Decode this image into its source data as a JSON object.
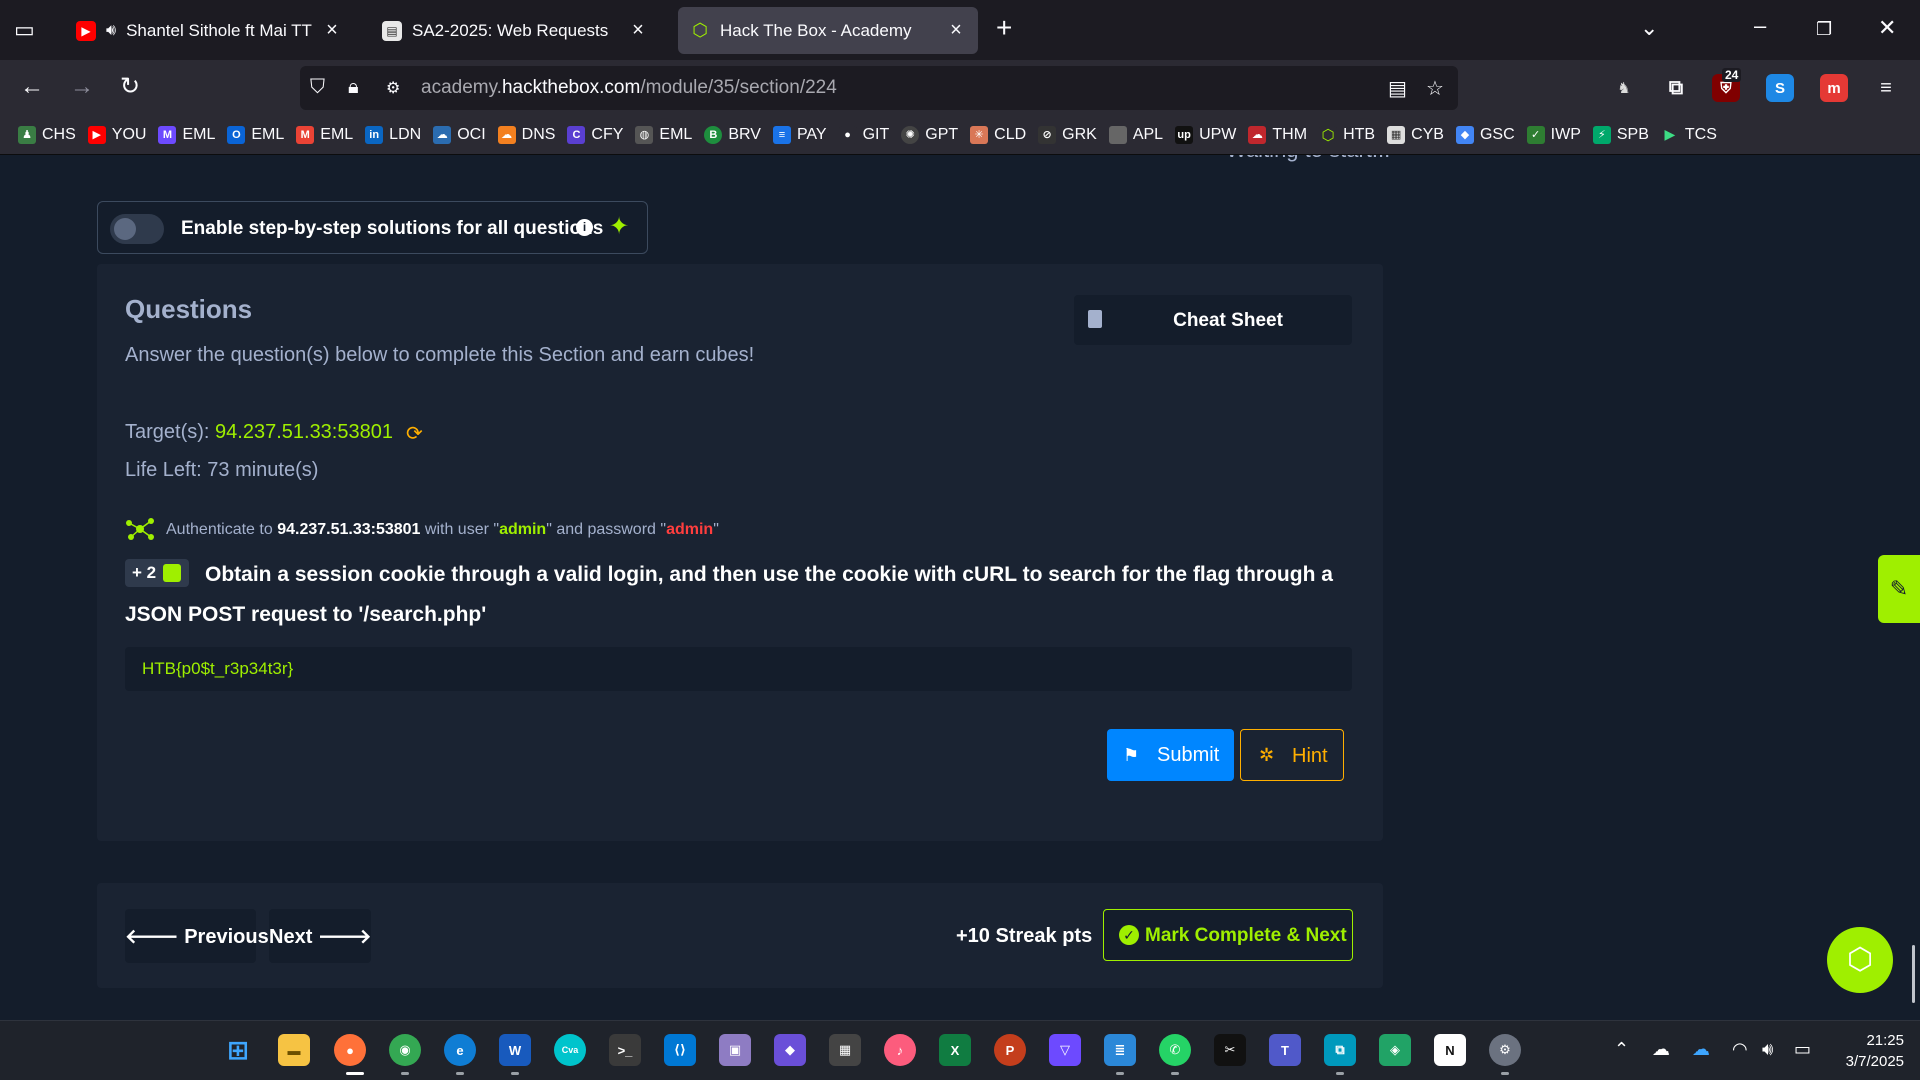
{
  "browser": {
    "tabs": [
      {
        "title": "Shantel Sithole ft Mai TT - K",
        "icon": "youtube-icon",
        "audio": "speaker-icon"
      },
      {
        "title": "SA2-2025: Web Requests",
        "icon": "page-icon"
      },
      {
        "title": "Hack The Box - Academy",
        "icon": "htb-cube-icon",
        "active": true
      }
    ],
    "url_prefix": "academy.",
    "url_domain": "hackthebox.com",
    "url_path": "/module/35/section/224",
    "extension_badge": "24"
  },
  "bookmarks": [
    "CHS",
    "YOU",
    "EML",
    "EML",
    "EML",
    "LDN",
    "OCI",
    "DNS",
    "CFY",
    "EML",
    "BRV",
    "PAY",
    "GIT",
    "GPT",
    "CLD",
    "GRK",
    "APL",
    "UPW",
    "THM",
    "HTB",
    "CYB",
    "GSC",
    "IWP",
    "SPB",
    "TCS"
  ],
  "page": {
    "waiting_text": "Waiting to start...",
    "toggle_label": "Enable step-by-step solutions for all questions",
    "toggle_on": false,
    "questions": {
      "title": "Questions",
      "subtitle": "Answer the question(s) below to complete this Section and earn cubes!",
      "cheat_sheet_label": "Cheat Sheet",
      "target_label": "Target(s):",
      "target_ip": "94.237.51.33:53801",
      "life_left": "Life Left: 73 minute(s)",
      "auth": {
        "prefix": "Authenticate to",
        "host": "94.237.51.33:53801",
        "with_user": "with user \"",
        "user": "admin",
        "and_password": "\" and password \"",
        "password": "admin",
        "suffix": "\""
      },
      "badge": "+ 2",
      "question": "Obtain a session cookie through a valid login, and then use the cookie with cURL to search for the flag through a JSON POST request to '/search.php'",
      "answer_value": "HTB{p0$t_r3p34t3r}",
      "submit_label": "Submit",
      "hint_label": "Hint"
    },
    "nav": {
      "previous_label": "Previous",
      "next_label": "Next",
      "streak": "+10 Streak pts",
      "mark_complete_label": "Mark Complete & Next"
    }
  },
  "taskbar": {
    "time": "21:25",
    "date": "3/7/2025"
  },
  "colors": {
    "accent": "#9fef00",
    "background": "#141d2b",
    "card": "#1a2332",
    "muted_text": "#a4b1cd",
    "submit": "#0086ff",
    "hint": "#ffaf00",
    "danger": "#ff3e3e"
  }
}
